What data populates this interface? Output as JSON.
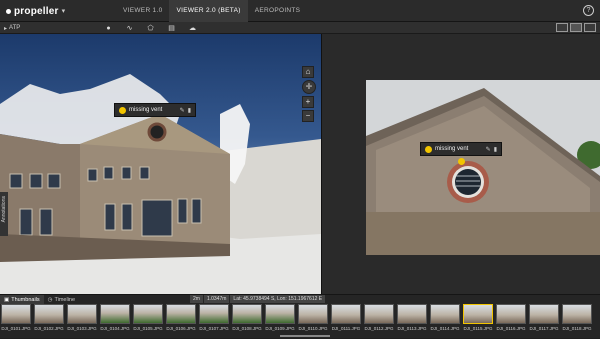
{
  "app": {
    "logo_text": "propeller"
  },
  "nav": {
    "tabs": [
      "VIEWER 1.0",
      "VIEWER 2.0 (BETA)",
      "AEROPOINTS"
    ],
    "active": 1
  },
  "help": {
    "label": "?"
  },
  "breadcrumb": {
    "label": "ATP"
  },
  "left_pane": {
    "side_tab": "Annotations",
    "annotation": "missing vent"
  },
  "right_pane": {
    "annotation": "missing vent"
  },
  "bottom": {
    "tabs": [
      "Thumbnails",
      "Timeline"
    ],
    "status": [
      "2m",
      "1.0347m",
      "Lat: 45.9738494 S, Lon: 151.1967612 E"
    ],
    "thumbnails": [
      "DJI_0101.JPG",
      "DJI_0102.JPG",
      "DJI_0103.JPG",
      "DJI_0104.JPG",
      "DJI_0105.JPG",
      "DJI_0106.JPG",
      "DJI_0107.JPG",
      "DJI_0108.JPG",
      "DJI_0109.JPG",
      "DJI_0110.JPG",
      "DJI_0111.JPG",
      "DJI_0112.JPG",
      "DJI_0113.JPG",
      "DJI_0114.JPG",
      "DJI_0115.JPG",
      "DJI_0116.JPG",
      "DJI_0117.JPG",
      "DJI_0118.JPG"
    ]
  },
  "colors": {
    "accent": "#f2c500",
    "background": "#1f1f1f",
    "topbar": "#2b2b2b"
  }
}
